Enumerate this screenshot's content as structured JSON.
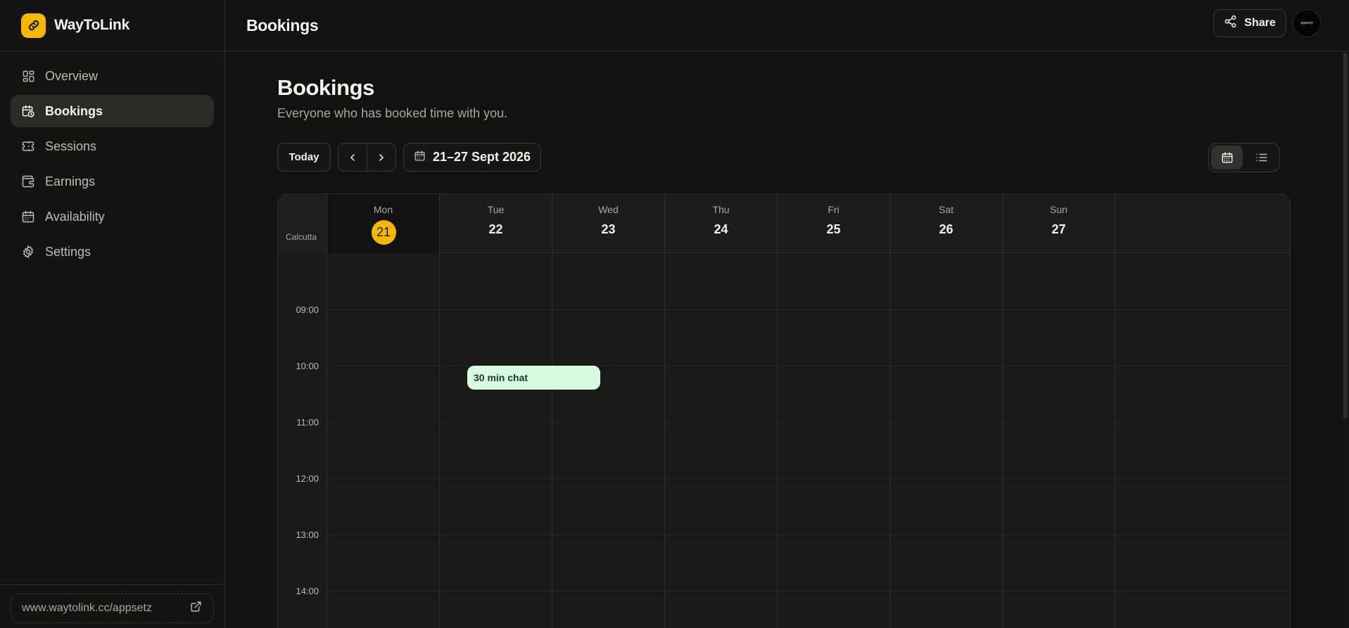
{
  "brand": {
    "name": "WayToLink",
    "accent": "#f5b800"
  },
  "sidebar": {
    "items": [
      {
        "label": "Overview",
        "icon": "grid-icon",
        "active": false
      },
      {
        "label": "Bookings",
        "icon": "calendar-clock-icon",
        "active": true
      },
      {
        "label": "Sessions",
        "icon": "ticket-icon",
        "active": false
      },
      {
        "label": "Earnings",
        "icon": "wallet-icon",
        "active": false
      },
      {
        "label": "Availability",
        "icon": "calendar-icon",
        "active": false
      },
      {
        "label": "Settings",
        "icon": "gear-icon",
        "active": false
      }
    ],
    "footer_link": "www.waytolink.cc/appsetz"
  },
  "header": {
    "title": "Bookings",
    "share_label": "Share",
    "avatar_text": "appsetz"
  },
  "page": {
    "title": "Bookings",
    "subtitle": "Everyone who has booked time with you."
  },
  "toolbar": {
    "today_label": "Today",
    "range_label": "21–27 Sept 2026"
  },
  "calendar": {
    "timezone": "Calcutta",
    "days": [
      {
        "dow": "Mon",
        "num": "21",
        "today": true
      },
      {
        "dow": "Tue",
        "num": "22",
        "today": false
      },
      {
        "dow": "Wed",
        "num": "23",
        "today": false
      },
      {
        "dow": "Thu",
        "num": "24",
        "today": false
      },
      {
        "dow": "Fri",
        "num": "25",
        "today": false
      },
      {
        "dow": "Sat",
        "num": "26",
        "today": false
      },
      {
        "dow": "Sun",
        "num": "27",
        "today": false
      }
    ],
    "times": [
      "09:00",
      "10:00",
      "11:00",
      "12:00",
      "13:00",
      "14:00"
    ],
    "events": [
      {
        "title": "30 min chat",
        "day": "Tue",
        "start": "10:00",
        "color": "#d9fbe2"
      }
    ]
  }
}
